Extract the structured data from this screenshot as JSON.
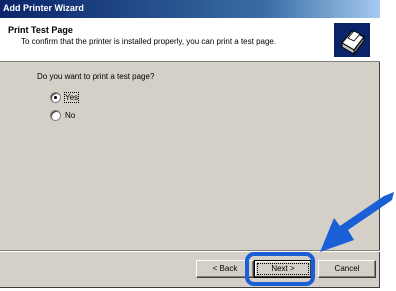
{
  "window": {
    "title": "Add Printer Wizard"
  },
  "header": {
    "title": "Print Test Page",
    "subtitle": "To confirm that the printer is installed properly, you can print a test page.",
    "icon": "printer-icon"
  },
  "content": {
    "question": "Do you want to print a test page?",
    "options": [
      {
        "label": "Yes",
        "selected": true
      },
      {
        "label": "No",
        "selected": false
      }
    ]
  },
  "buttons": {
    "back": "< Back",
    "next": "Next >",
    "cancel": "Cancel"
  },
  "colors": {
    "callout": "#1a5fd6",
    "titlebar": "#0a246a",
    "dialog": "#d4d0c8"
  }
}
